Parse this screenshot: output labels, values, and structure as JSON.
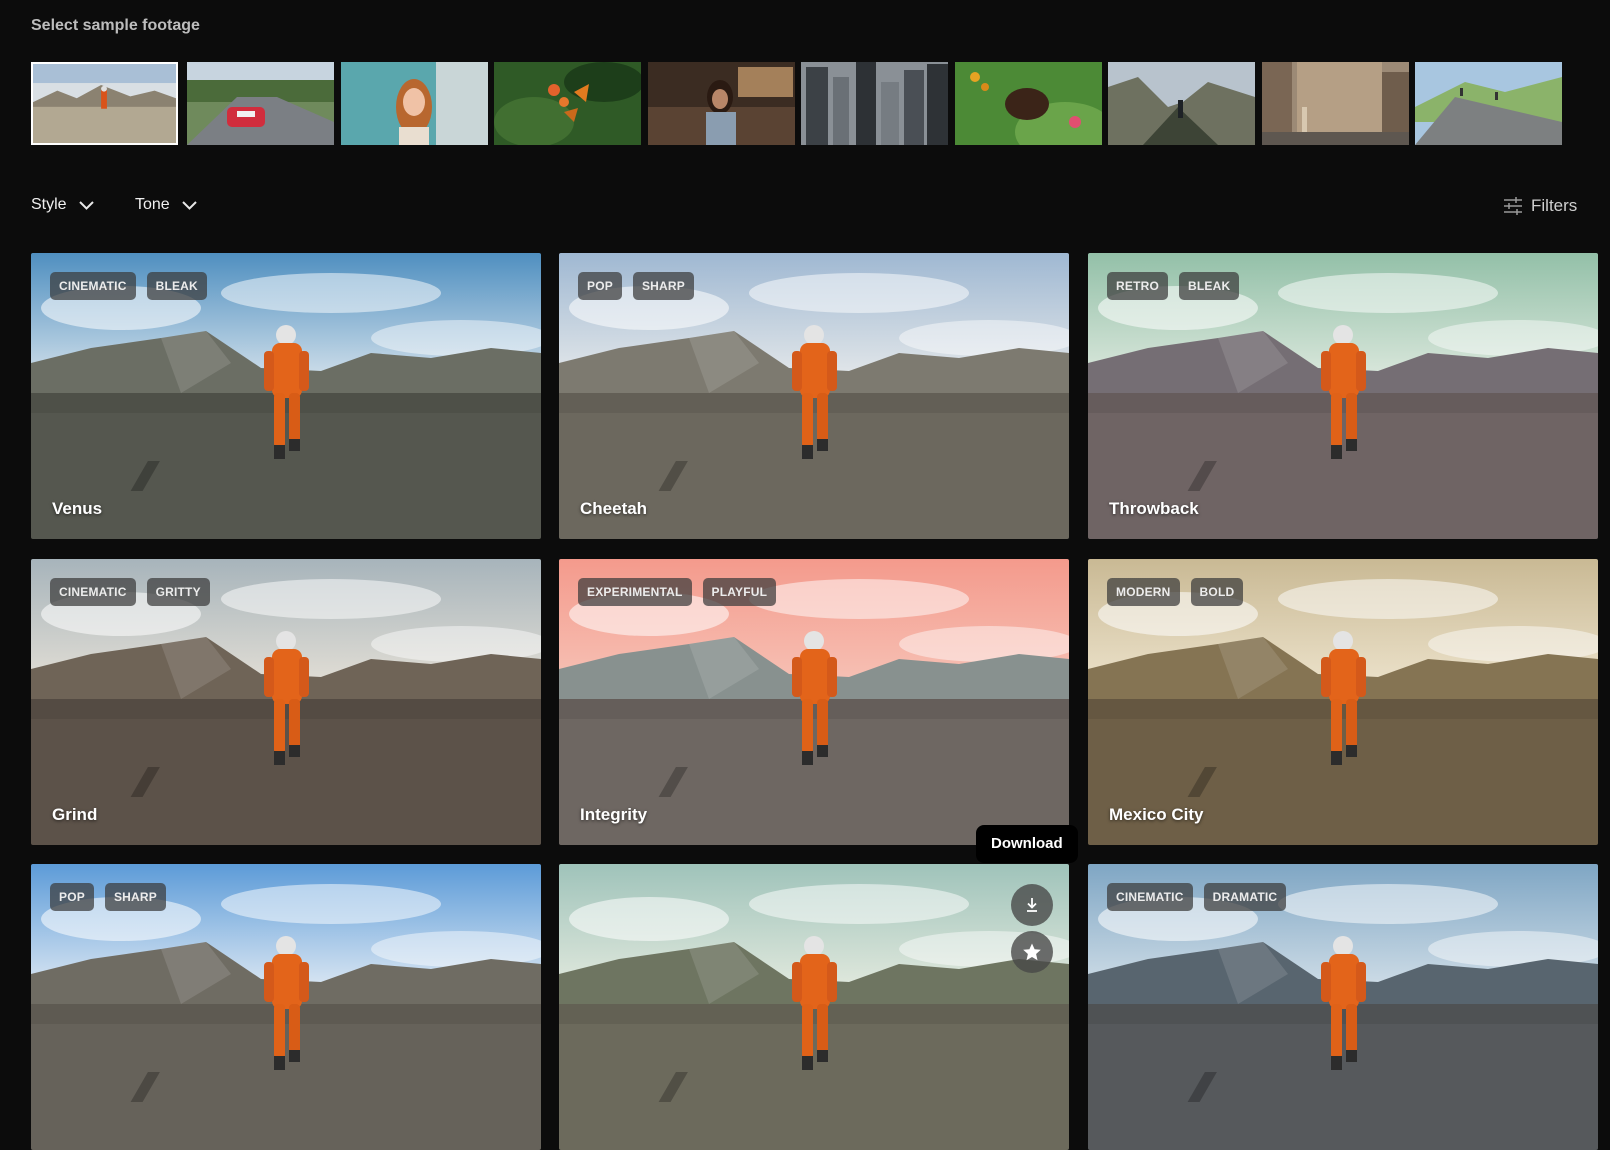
{
  "section_title": "Select sample footage",
  "footage_thumbs": [
    {
      "icon": "astronaut-desert",
      "selected": true
    },
    {
      "icon": "red-car-road",
      "selected": false
    },
    {
      "icon": "woman-portrait",
      "selected": false
    },
    {
      "icon": "butterfly-flower",
      "selected": false
    },
    {
      "icon": "woman-cafe",
      "selected": false
    },
    {
      "icon": "city-skyscrapers",
      "selected": false
    },
    {
      "icon": "woman-grass",
      "selected": false
    },
    {
      "icon": "hiker-mountains",
      "selected": false
    },
    {
      "icon": "street-building",
      "selected": false
    },
    {
      "icon": "road-hills",
      "selected": false
    }
  ],
  "toolbar": {
    "style_label": "Style",
    "tone_label": "Tone",
    "filters_label": "Filters"
  },
  "looks": [
    {
      "name": "Venus",
      "tags": [
        "CINEMATIC",
        "BLEAK"
      ],
      "palette": {
        "sky1": "#4f8fc0",
        "sky2": "#e8eef2",
        "mtn": "#6b6e64",
        "ground": "#55574f"
      }
    },
    {
      "name": "Cheetah",
      "tags": [
        "POP",
        "SHARP"
      ],
      "palette": {
        "sky1": "#9fb8d2",
        "sky2": "#f0f0ee",
        "mtn": "#7d7a70",
        "ground": "#6c685e"
      }
    },
    {
      "name": "Throwback",
      "tags": [
        "RETRO",
        "BLEAK"
      ],
      "palette": {
        "sky1": "#93c0a8",
        "sky2": "#e8efe6",
        "mtn": "#756e74",
        "ground": "#6f6464"
      }
    },
    {
      "name": "Grind",
      "tags": [
        "CINEMATIC",
        "GRITTY"
      ],
      "palette": {
        "sky1": "#a7b4bb",
        "sky2": "#ede6da",
        "mtn": "#6f6457",
        "ground": "#5c5249"
      }
    },
    {
      "name": "Integrity",
      "tags": [
        "EXPERIMENTAL",
        "PLAYFUL"
      ],
      "palette": {
        "sky1": "#f49a8c",
        "sky2": "#f7c9bd",
        "mtn": "#88918f",
        "ground": "#6e6762"
      }
    },
    {
      "name": "Mexico City",
      "tags": [
        "MODERN",
        "BOLD"
      ],
      "palette": {
        "sky1": "#c9b994",
        "sky2": "#f2e9d4",
        "mtn": "#857453",
        "ground": "#6e5f47"
      }
    },
    {
      "name": "",
      "tags": [
        "POP",
        "SHARP"
      ],
      "palette": {
        "sky1": "#5c9bd8",
        "sky2": "#f4f6f8",
        "mtn": "#6f6c63",
        "ground": "#66625a"
      }
    },
    {
      "name": "",
      "tags": [],
      "palette": {
        "sky1": "#9fc3ba",
        "sky2": "#eef0e4",
        "mtn": "#6e7561",
        "ground": "#6c6a5c"
      }
    },
    {
      "name": "",
      "tags": [
        "CINEMATIC",
        "DRAMATIC"
      ],
      "palette": {
        "sky1": "#7fa6c4",
        "sky2": "#dfe8ee",
        "mtn": "#58656f",
        "ground": "#56595c"
      }
    }
  ],
  "hover_card": {
    "tooltip": "Download",
    "download_icon": "download-icon",
    "favorite_icon": "star-icon"
  }
}
